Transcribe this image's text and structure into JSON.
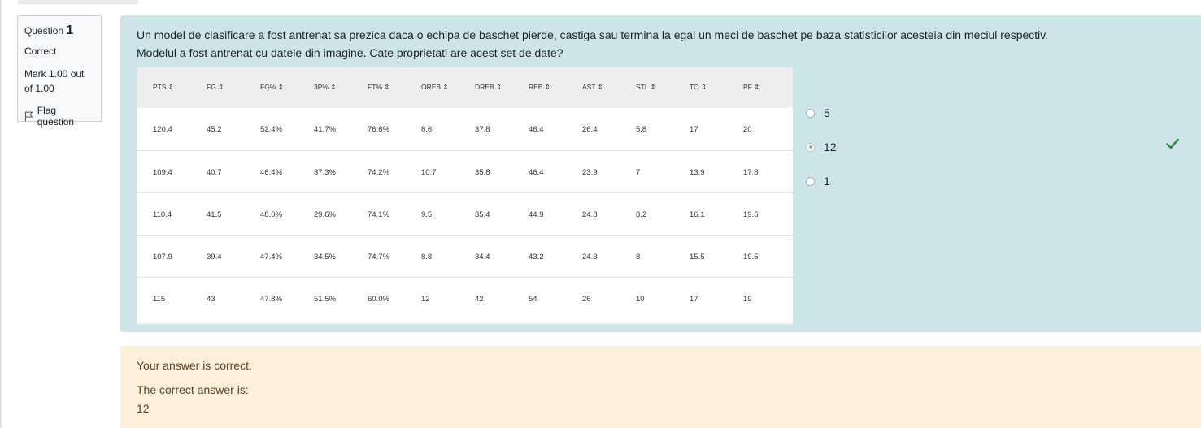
{
  "info": {
    "question_label": "Question",
    "question_number": "1",
    "state": "Correct",
    "grade": "Mark 1.00 out of 1.00",
    "flag_label": "Flag question"
  },
  "question": {
    "text_line1": "Un model de clasificare a fost antrenat sa prezica daca o echipa de baschet pierde, castiga sau termina la egal un meci de baschet pe baza statisticilor acesteia din meciul respectiv.",
    "text_line2": "Modelul a fost antrenat cu datele din imagine. Cate proprietati are acest set de date?"
  },
  "table": {
    "headers": [
      "PTS ⇕",
      "FG ⇕",
      "FG% ⇕",
      "3P% ⇕",
      "FT% ⇕",
      "OREB ⇕",
      "DREB ⇕",
      "REB ⇕",
      "AST ⇕",
      "STL ⇕",
      "TO ⇕",
      "PF ⇕"
    ],
    "rows": [
      [
        "120.4",
        "45.2",
        "52.4%",
        "41.7%",
        "76.6%",
        "8.6",
        "37.8",
        "46.4",
        "26.4",
        "5.8",
        "17",
        "20"
      ],
      [
        "109.4",
        "40.7",
        "46.4%",
        "37.3%",
        "74.2%",
        "10.7",
        "35.8",
        "46.4",
        "23.9",
        "7",
        "13.9",
        "17.8"
      ],
      [
        "110.4",
        "41.5",
        "48.0%",
        "29.6%",
        "74.1%",
        "9.5",
        "35.4",
        "44.9",
        "24.8",
        "8.2",
        "16.1",
        "19.6"
      ],
      [
        "107.9",
        "39.4",
        "47.4%",
        "34.5%",
        "74.7%",
        "8.8",
        "34.4",
        "43.2",
        "24.3",
        "8",
        "15.5",
        "19.5"
      ],
      [
        "115",
        "43",
        "47.8%",
        "51.5%",
        "60.0%",
        "12",
        "42",
        "54",
        "26",
        "10",
        "17",
        "19"
      ]
    ]
  },
  "answers": {
    "options": [
      {
        "label": "5",
        "selected": false
      },
      {
        "label": "12",
        "selected": true
      },
      {
        "label": "1",
        "selected": false
      }
    ],
    "correct_mark": "check-icon",
    "correct_color": "#3a8a3a"
  },
  "feedback": {
    "result": "Your answer is correct.",
    "correct_label": "The correct answer is:",
    "correct_value": "12"
  },
  "colors": {
    "formulation_bg": "#cde5e9",
    "outcome_bg": "#fcefdc",
    "info_bg": "#f8f9fa"
  }
}
